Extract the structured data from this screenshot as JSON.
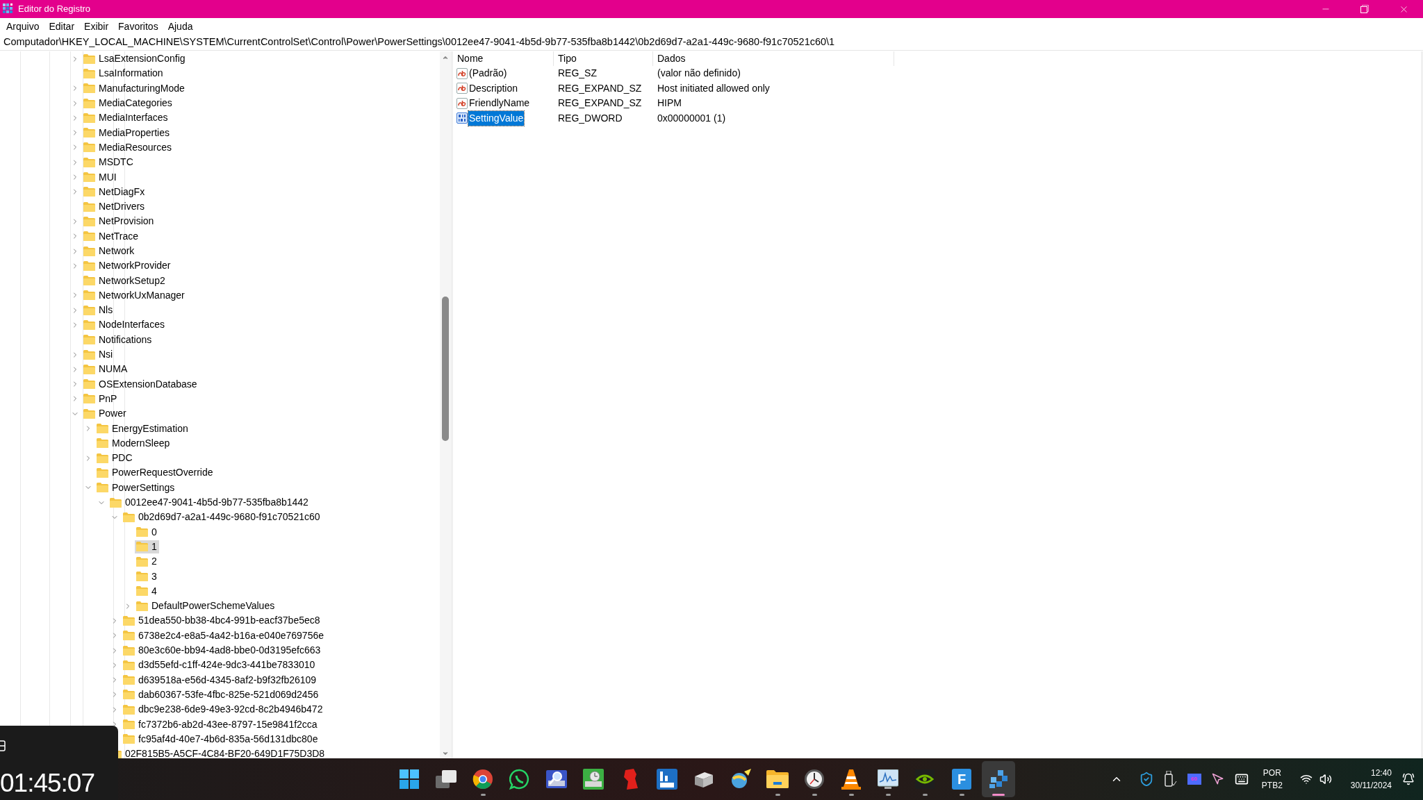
{
  "window": {
    "title": "Editor do Registro"
  },
  "menu": [
    "Arquivo",
    "Editar",
    "Exibir",
    "Favoritos",
    "Ajuda"
  ],
  "address": "Computador\\HKEY_LOCAL_MACHINE\\SYSTEM\\CurrentControlSet\\Control\\Power\\PowerSettings\\0012ee47-9041-4b5d-9b77-535fba8b1442\\0b2d69d7-a2a1-449c-9680-f91c70521c60\\1",
  "tree": [
    {
      "name": "LsaExtensionConfig",
      "expandable": true,
      "expanded": false,
      "selected": false
    },
    {
      "name": "LsaInformation",
      "expandable": false,
      "expanded": false,
      "selected": false
    },
    {
      "name": "ManufacturingMode",
      "expandable": true,
      "expanded": false,
      "selected": false
    },
    {
      "name": "MediaCategories",
      "expandable": true,
      "expanded": false,
      "selected": false
    },
    {
      "name": "MediaInterfaces",
      "expandable": true,
      "expanded": false,
      "selected": false
    },
    {
      "name": "MediaProperties",
      "expandable": true,
      "expanded": false,
      "selected": false
    },
    {
      "name": "MediaResources",
      "expandable": true,
      "expanded": false,
      "selected": false
    },
    {
      "name": "MSDTC",
      "expandable": true,
      "expanded": false,
      "selected": false
    },
    {
      "name": "MUI",
      "expandable": true,
      "expanded": false,
      "selected": false
    },
    {
      "name": "NetDiagFx",
      "expandable": true,
      "expanded": false,
      "selected": false
    },
    {
      "name": "NetDrivers",
      "expandable": false,
      "expanded": false,
      "selected": false
    },
    {
      "name": "NetProvision",
      "expandable": true,
      "expanded": false,
      "selected": false
    },
    {
      "name": "NetTrace",
      "expandable": true,
      "expanded": false,
      "selected": false
    },
    {
      "name": "Network",
      "expandable": true,
      "expanded": false,
      "selected": false
    },
    {
      "name": "NetworkProvider",
      "expandable": true,
      "expanded": false,
      "selected": false
    },
    {
      "name": "NetworkSetup2",
      "expandable": false,
      "expanded": false,
      "selected": false
    },
    {
      "name": "NetworkUxManager",
      "expandable": true,
      "expanded": false,
      "selected": false
    },
    {
      "name": "Nls",
      "expandable": true,
      "expanded": false,
      "selected": false
    },
    {
      "name": "NodeInterfaces",
      "expandable": true,
      "expanded": false,
      "selected": false
    },
    {
      "name": "Notifications",
      "expandable": false,
      "expanded": false,
      "selected": false
    },
    {
      "name": "Nsi",
      "expandable": true,
      "expanded": false,
      "selected": false
    },
    {
      "name": "NUMA",
      "expandable": true,
      "expanded": false,
      "selected": false
    },
    {
      "name": "OSExtensionDatabase",
      "expandable": true,
      "expanded": false,
      "selected": false
    },
    {
      "name": "PnP",
      "expandable": true,
      "expanded": false,
      "selected": false
    },
    {
      "name": "Power",
      "expandable": true,
      "expanded": true,
      "selected": false,
      "children": [
        {
          "name": "EnergyEstimation",
          "expandable": true,
          "expanded": false,
          "selected": false
        },
        {
          "name": "ModernSleep",
          "expandable": false,
          "expanded": false,
          "selected": false
        },
        {
          "name": "PDC",
          "expandable": true,
          "expanded": false,
          "selected": false
        },
        {
          "name": "PowerRequestOverride",
          "expandable": false,
          "expanded": false,
          "selected": false
        },
        {
          "name": "PowerSettings",
          "expandable": true,
          "expanded": true,
          "selected": false,
          "children": [
            {
              "name": "0012ee47-9041-4b5d-9b77-535fba8b1442",
              "expandable": true,
              "expanded": true,
              "selected": false,
              "children": [
                {
                  "name": "0b2d69d7-a2a1-449c-9680-f91c70521c60",
                  "expandable": true,
                  "expanded": true,
                  "selected": false,
                  "children": [
                    {
                      "name": "0",
                      "expandable": false,
                      "expanded": false,
                      "selected": false
                    },
                    {
                      "name": "1",
                      "expandable": false,
                      "expanded": false,
                      "selected": true
                    },
                    {
                      "name": "2",
                      "expandable": false,
                      "expanded": false,
                      "selected": false
                    },
                    {
                      "name": "3",
                      "expandable": false,
                      "expanded": false,
                      "selected": false
                    },
                    {
                      "name": "4",
                      "expandable": false,
                      "expanded": false,
                      "selected": false
                    },
                    {
                      "name": "DefaultPowerSchemeValues",
                      "expandable": true,
                      "expanded": false,
                      "selected": false
                    }
                  ]
                },
                {
                  "name": "51dea550-bb38-4bc4-991b-eacf37be5ec8",
                  "expandable": true,
                  "expanded": false,
                  "selected": false
                },
                {
                  "name": "6738e2c4-e8a5-4a42-b16a-e040e769756e",
                  "expandable": true,
                  "expanded": false,
                  "selected": false
                },
                {
                  "name": "80e3c60e-bb94-4ad8-bbe0-0d3195efc663",
                  "expandable": true,
                  "expanded": false,
                  "selected": false
                },
                {
                  "name": "d3d55efd-c1ff-424e-9dc3-441be7833010",
                  "expandable": true,
                  "expanded": false,
                  "selected": false
                },
                {
                  "name": "d639518a-e56d-4345-8af2-b9f32fb26109",
                  "expandable": true,
                  "expanded": false,
                  "selected": false
                },
                {
                  "name": "dab60367-53fe-4fbc-825e-521d069d2456",
                  "expandable": true,
                  "expanded": false,
                  "selected": false
                },
                {
                  "name": "dbc9e238-6de9-49e3-92cd-8c2b4946b472",
                  "expandable": true,
                  "expanded": false,
                  "selected": false
                },
                {
                  "name": "fc7372b6-ab2d-43ee-8797-15e9841f2cca",
                  "expandable": true,
                  "expanded": false,
                  "selected": false
                },
                {
                  "name": "fc95af4d-40e7-4b6d-835a-56d131dbc80e",
                  "expandable": false,
                  "expanded": false,
                  "selected": false
                }
              ]
            },
            {
              "name": "02F815B5-A5CF-4C84-BF20-649D1F75D3D8",
              "expandable": false,
              "expanded": false,
              "selected": false
            }
          ]
        }
      ]
    }
  ],
  "values": {
    "columns": [
      "Nome",
      "Tipo",
      "Dados"
    ],
    "rows": [
      {
        "name": "(Padrão)",
        "type": "REG_SZ",
        "data": "(valor não definido)",
        "kind": "string",
        "selected": false
      },
      {
        "name": "Description",
        "type": "REG_EXPAND_SZ",
        "data": "Host initiated allowed only",
        "kind": "string",
        "selected": false
      },
      {
        "name": "FriendlyName",
        "type": "REG_EXPAND_SZ",
        "data": "HIPM",
        "kind": "string",
        "selected": false
      },
      {
        "name": "SettingValue",
        "type": "REG_DWORD",
        "data": "0x00000001 (1)",
        "kind": "binary",
        "selected": true
      }
    ]
  },
  "overlay": {
    "timer": "01:45:07"
  },
  "taskbar": {
    "apps": [
      {
        "kind": "start",
        "running": false,
        "active": false
      },
      {
        "kind": "task-view",
        "running": false,
        "active": false
      },
      {
        "kind": "browser",
        "running": true,
        "active": false
      },
      {
        "kind": "chat",
        "running": false,
        "active": false
      },
      {
        "kind": "disk-search",
        "running": false,
        "active": false
      },
      {
        "kind": "disk-clock",
        "running": false,
        "active": false
      },
      {
        "kind": "red-figure",
        "running": false,
        "active": false
      },
      {
        "kind": "bars-tile",
        "running": false,
        "active": false
      },
      {
        "kind": "device",
        "running": false,
        "active": false
      },
      {
        "kind": "wand",
        "running": false,
        "active": false
      },
      {
        "kind": "folder",
        "running": true,
        "active": false
      },
      {
        "kind": "clock",
        "running": true,
        "active": false
      },
      {
        "kind": "cone",
        "running": true,
        "active": false
      },
      {
        "kind": "monitor",
        "running": true,
        "active": false
      },
      {
        "kind": "eye-tile",
        "running": true,
        "active": false
      },
      {
        "kind": "letter-tile",
        "label": "F",
        "running": true,
        "active": false
      },
      {
        "kind": "cubes",
        "running": true,
        "active": true
      }
    ],
    "tray": {
      "display_badge": "60",
      "language": "POR",
      "layout": "PTB2",
      "time": "12:40",
      "date": "30/11/2024"
    }
  }
}
